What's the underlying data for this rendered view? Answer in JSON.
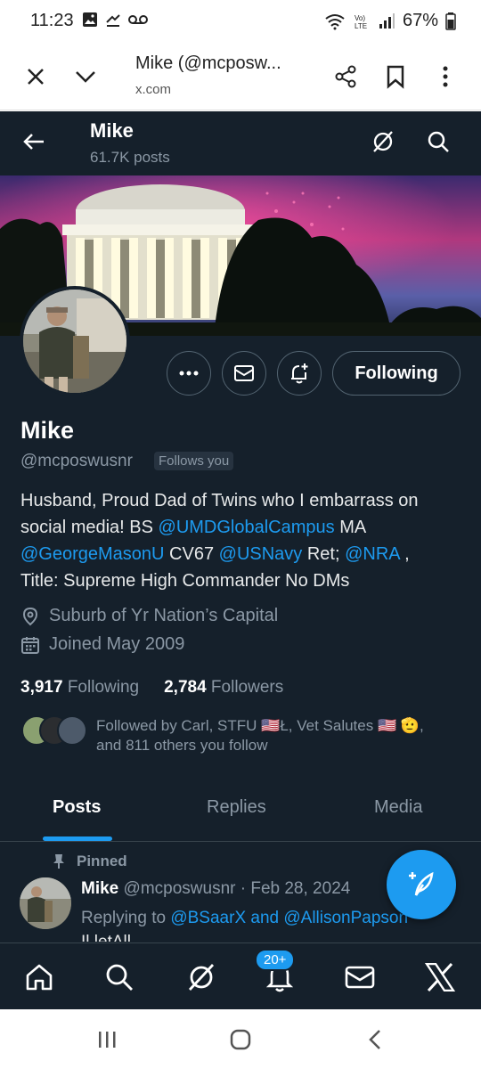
{
  "status_bar": {
    "time": "11:23",
    "battery_pct": "67%",
    "icons": [
      "image-icon",
      "missed-call-icon",
      "voicemail-icon",
      "wifi-icon",
      "volte-icon",
      "signal-icon",
      "battery-icon"
    ]
  },
  "browser": {
    "page_title": "Mike (@mcposw...",
    "domain": "x.com",
    "icons": [
      "close-icon",
      "chevron-down-icon",
      "share-icon",
      "bookmark-icon",
      "more-vertical-icon"
    ]
  },
  "header": {
    "name": "Mike",
    "posts_count": "61.7K posts"
  },
  "profile": {
    "name": "Mike",
    "handle": "@mcposwusnr",
    "follows_you": "Follows you",
    "following_button": "Following",
    "bio": {
      "line1": "Husband, Proud Dad of Twins who I embarrass on",
      "line2_prefix": "social media! BS ",
      "mention1": "@UMDGlobalCampus",
      "line2_suffix": " MA",
      "mention2": "@GeorgeMasonU",
      "line3_mid": " CV67 ",
      "mention3": "@USNavy",
      "line3_mid2": " Ret; ",
      "mention4": "@NRA",
      "line3_suffix": " ,",
      "line4": "Title: Supreme High Commander No DMs"
    },
    "location": "Suburb of Yr Nation’s Capital",
    "joined": "Joined May 2009",
    "following_count": "3,917",
    "following_label": "Following",
    "followers_count": "2,784",
    "followers_label": "Followers",
    "followed_by_line1": "Followed by Carl, STFU 🇺🇸Ł, Vet Salutes 🇺🇸 🫡,",
    "followed_by_line2": "and 811 others you follow"
  },
  "tabs": [
    {
      "label": "Posts",
      "active": true
    },
    {
      "label": "Replies",
      "active": false
    },
    {
      "label": "Media",
      "active": false
    }
  ],
  "pinned_post": {
    "pinned_label": "Pinned",
    "author": "Mike",
    "handle_date": " @mcposwusnr · Feb 28, 2024",
    "replying_prefix": "Replying to ",
    "replying_to": "@BSaarX and @AllisonPapson",
    "text_cut": "Il letAll"
  },
  "bottom_nav": {
    "notification_badge": "20+"
  },
  "colors": {
    "background": "#15202b",
    "accent": "#1d9bf0",
    "secondary_text": "#8b98a5",
    "border": "#536471"
  }
}
